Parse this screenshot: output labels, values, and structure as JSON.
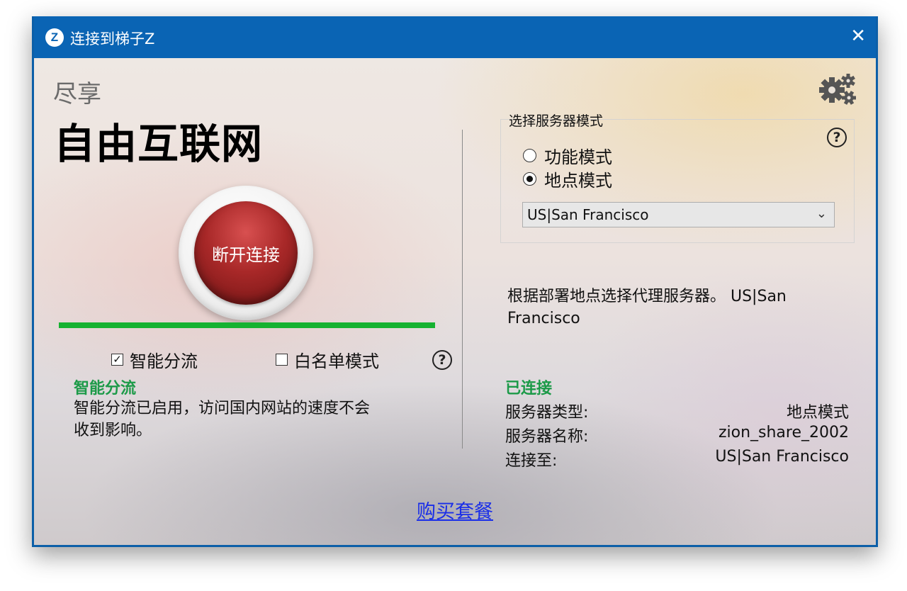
{
  "window": {
    "title": "连接到梯子Z",
    "icon_letter": "Z",
    "close_glyph": "✕"
  },
  "header": {
    "enjoy": "尽享",
    "slogan": "自由互联网"
  },
  "connect_button": {
    "label": "断开连接"
  },
  "progress": {
    "value": 1.0,
    "color": "#16b231"
  },
  "options": {
    "smart_split": {
      "label": "智能分流",
      "checked": true,
      "check_glyph": "✓"
    },
    "whitelist": {
      "label": "白名单模式",
      "checked": false
    },
    "help_glyph": "?"
  },
  "smart_split_info": {
    "heading": "智能分流",
    "text_line1": "智能分流已启用，访问国内网站的速度不会",
    "text_line2": "收到影响。"
  },
  "server_mode": {
    "title": "选择服务器模式",
    "options": [
      {
        "label": "功能模式",
        "selected": false
      },
      {
        "label": "地点模式",
        "selected": true
      }
    ],
    "location": {
      "value": "US|San Francisco",
      "arrow": "⌄"
    },
    "help_glyph": "?"
  },
  "description": {
    "line1": "根据部署地点选择代理服务器。 US|San",
    "line2": "Francisco"
  },
  "status": {
    "heading": "已连接",
    "rows": [
      {
        "label": "服务器类型:",
        "value": "地点模式"
      },
      {
        "label": "服务器名称:",
        "value": "zion_share_2002"
      },
      {
        "label": "连接至:",
        "value": "US|San Francisco"
      }
    ]
  },
  "footer": {
    "buy_link": "购买套餐"
  },
  "icons": {
    "settings": "gears-icon",
    "app": "app-logo-icon",
    "close": "close-icon"
  },
  "colors": {
    "titlebar": "#0a64b4",
    "accent_green": "#1c9a48",
    "link": "#1a2ee8",
    "button_red": "#a82828"
  }
}
